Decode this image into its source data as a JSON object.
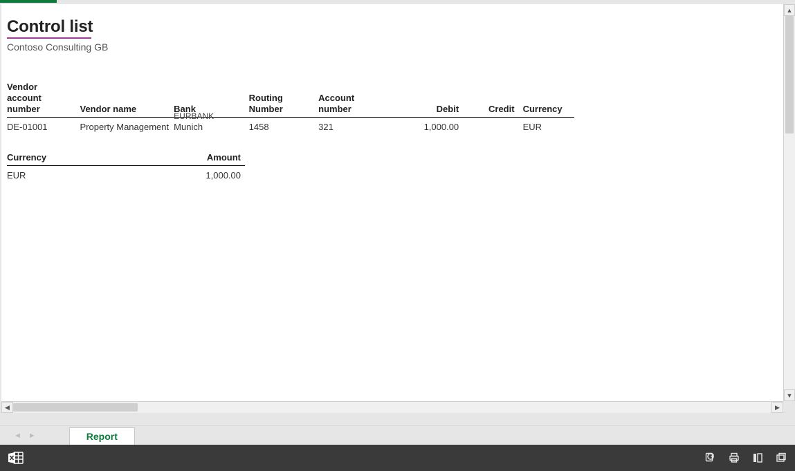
{
  "report": {
    "title": "Control list",
    "subtitle": "Contoso Consulting GB"
  },
  "vendors": {
    "headers": {
      "vendor_account": "Vendor account number",
      "vendor_name": "Vendor name",
      "bank": "Bank",
      "routing": "Routing Number",
      "account": "Account number",
      "debit": "Debit",
      "credit": "Credit",
      "currency": "Currency"
    },
    "rows": [
      {
        "vendor_account": "DE-01001",
        "vendor_name": "Property Management",
        "bank_truncated": "EURBANK",
        "bank": "Munich",
        "routing": "1458",
        "account": "321",
        "debit": "1,000.00",
        "credit": "",
        "currency": "EUR"
      }
    ]
  },
  "totals": {
    "headers": {
      "currency": "Currency",
      "amount": "Amount"
    },
    "rows": [
      {
        "currency": "EUR",
        "amount": "1,000.00"
      }
    ]
  },
  "tabs": {
    "active": "Report"
  },
  "statusbar": {
    "icons": {
      "excel": "excel-icon",
      "refresh": "refresh-icon",
      "print": "print-icon",
      "page": "page-layout-icon",
      "fullscreen": "fullscreen-icon"
    }
  }
}
